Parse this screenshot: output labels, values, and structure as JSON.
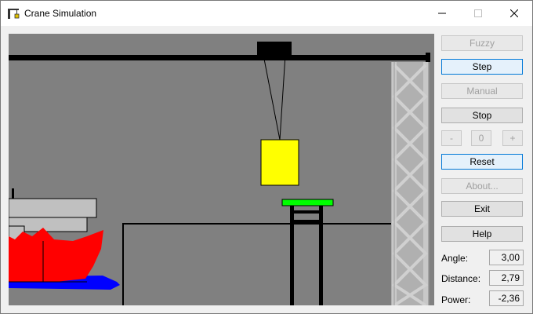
{
  "window": {
    "title": "Crane Simulation",
    "minimize_glyph": "—",
    "close_glyph": "✕"
  },
  "icons": {
    "app": "crane-icon",
    "minimize": "minimize-icon",
    "maximize": "maximize-icon",
    "close": "close-icon"
  },
  "colors": {
    "scene_background": "#808080",
    "container": "#ffff00",
    "target_platform": "#00ff00",
    "ship_hull": "#ff0000",
    "water": "#0000ff",
    "focus_border": "#0078d7"
  },
  "controls": {
    "fuzzy": "Fuzzy",
    "step": "Step",
    "manual": "Manual",
    "stop": "Stop",
    "minus": "-",
    "manual_value": "0",
    "plus": "+",
    "reset": "Reset",
    "about": "About...",
    "exit": "Exit",
    "help": "Help"
  },
  "readouts": {
    "angle_label": "Angle:",
    "angle_value": "3,00",
    "distance_label": "Distance:",
    "distance_value": "2,79",
    "power_label": "Power:",
    "power_value": "-2,36"
  }
}
